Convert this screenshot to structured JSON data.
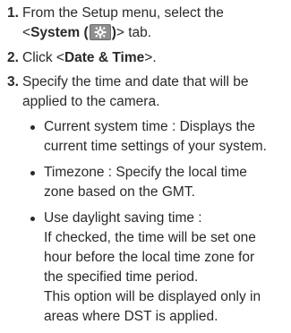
{
  "steps": [
    {
      "number": "1.",
      "text_before": "From the Setup menu, select the",
      "tab_open": "<",
      "tab_label": "System (",
      "tab_label_close": ")",
      "tab_close": "> tab.",
      "icon": "settings-gear-icon"
    },
    {
      "number": "2.",
      "text_before": "Click <",
      "label": "Date & Time",
      "text_after": ">."
    },
    {
      "number": "3.",
      "line1": "Specify the time and date that will be",
      "line2": "applied to the camera.",
      "bullets": [
        {
          "lines": [
            "Current system time : Displays the",
            "current time settings of your system."
          ]
        },
        {
          "lines": [
            "Timezone : Specify the local time",
            "zone based on the GMT."
          ]
        },
        {
          "lines": [
            "Use daylight saving time :",
            "If checked, the time will be set one",
            "hour before the local time zone for",
            "the specified time period.",
            "This option will be displayed only in",
            "areas where DST is applied."
          ]
        }
      ]
    }
  ]
}
